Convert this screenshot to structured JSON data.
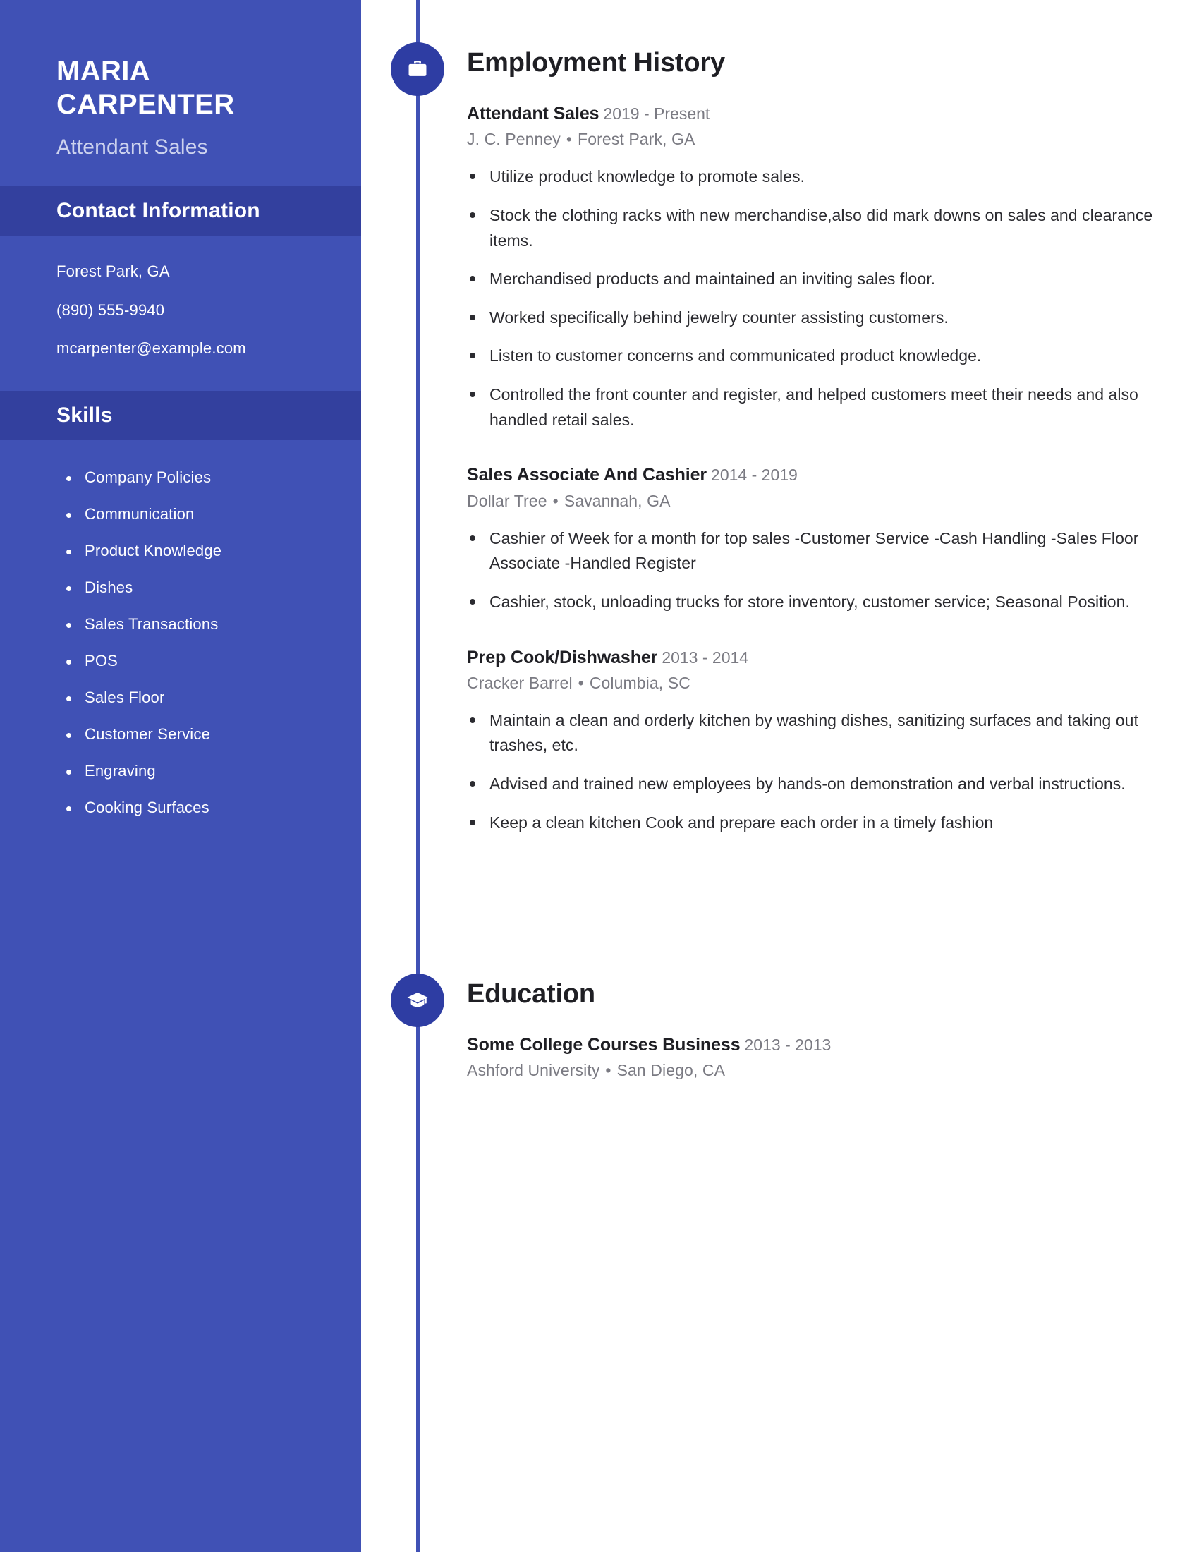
{
  "colors": {
    "sidebar_bg": "#4051B5",
    "sidebar_band_bg": "#33409E",
    "icon_circle_bg": "#2E3DA3",
    "timeline_rail": "#4051B5",
    "heading_text": "#1F1F24",
    "muted_text": "#7A7A82"
  },
  "sidebar": {
    "name_first": "MARIA",
    "name_last": "CARPENTER",
    "job_title": "Attendant Sales",
    "contact": {
      "heading": "Contact Information",
      "items": [
        "Forest Park, GA",
        "(890) 555-9940",
        "mcarpenter@example.com"
      ]
    },
    "skills": {
      "heading": "Skills",
      "items": [
        "Company Policies",
        "Communication",
        "Product Knowledge",
        "Dishes",
        "Sales Transactions",
        "POS",
        "Sales Floor",
        "Customer Service",
        "Engraving",
        "Cooking Surfaces"
      ]
    }
  },
  "main": {
    "employment": {
      "heading": "Employment History",
      "icon": "briefcase-icon",
      "entries": [
        {
          "role": "Attendant Sales",
          "dates": "2019 - Present",
          "company": "J. C. Penney",
          "separator": "•",
          "location": "Forest Park, GA",
          "bullets": [
            "Utilize product knowledge to promote sales.",
            "Stock the clothing racks with new merchandise,also did mark downs on sales and clearance items.",
            "Merchandised products and maintained an inviting sales floor.",
            "Worked specifically behind jewelry counter assisting customers.",
            "Listen to customer concerns and communicated product knowledge.",
            "Controlled the front counter and register, and helped customers meet their needs and also handled retail sales."
          ]
        },
        {
          "role": "Sales Associate And Cashier",
          "dates": "2014 - 2019",
          "company": "Dollar Tree",
          "separator": "•",
          "location": "Savannah, GA",
          "bullets": [
            "Cashier of Week for a month for top sales -Customer Service -Cash Handling -Sales Floor Associate -Handled Register",
            "Cashier, stock, unloading trucks for store inventory, customer service; Seasonal Position."
          ]
        },
        {
          "role": "Prep Cook/Dishwasher",
          "dates": "2013 - 2014",
          "company": "Cracker Barrel",
          "separator": "•",
          "location": "Columbia, SC",
          "bullets": [
            "Maintain a clean and orderly kitchen by washing dishes, sanitizing surfaces and taking out trashes, etc.",
            "Advised and trained new employees by hands-on demonstration and verbal instructions.",
            "Keep a clean kitchen Cook and prepare each order in a timely fashion"
          ]
        }
      ]
    },
    "education": {
      "heading": "Education",
      "icon": "graduation-cap-icon",
      "entries": [
        {
          "role": "Some College Courses Business",
          "dates": "2013 - 2013",
          "company": "Ashford University",
          "separator": "•",
          "location": "San Diego, CA",
          "bullets": []
        }
      ]
    }
  }
}
